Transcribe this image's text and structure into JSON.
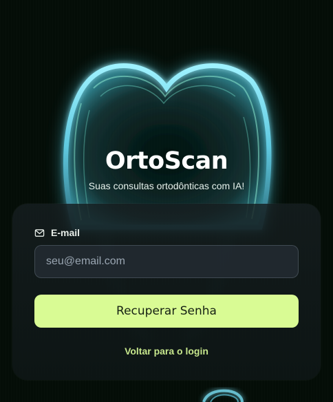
{
  "brand": {
    "title": "OrtoScan",
    "subtitle": "Suas consultas ortodônticas com IA!"
  },
  "form": {
    "email_label": "E-mail",
    "email_icon": "mail-icon",
    "email_placeholder": "seu@email.com",
    "email_value": "",
    "submit_label": "Recuperar Senha",
    "back_link_label": "Voltar para o login"
  },
  "colors": {
    "background": "#040d07",
    "accent": "#d9fb94",
    "link": "#c6e68c",
    "tooth_glow": "#7fe9ff"
  }
}
